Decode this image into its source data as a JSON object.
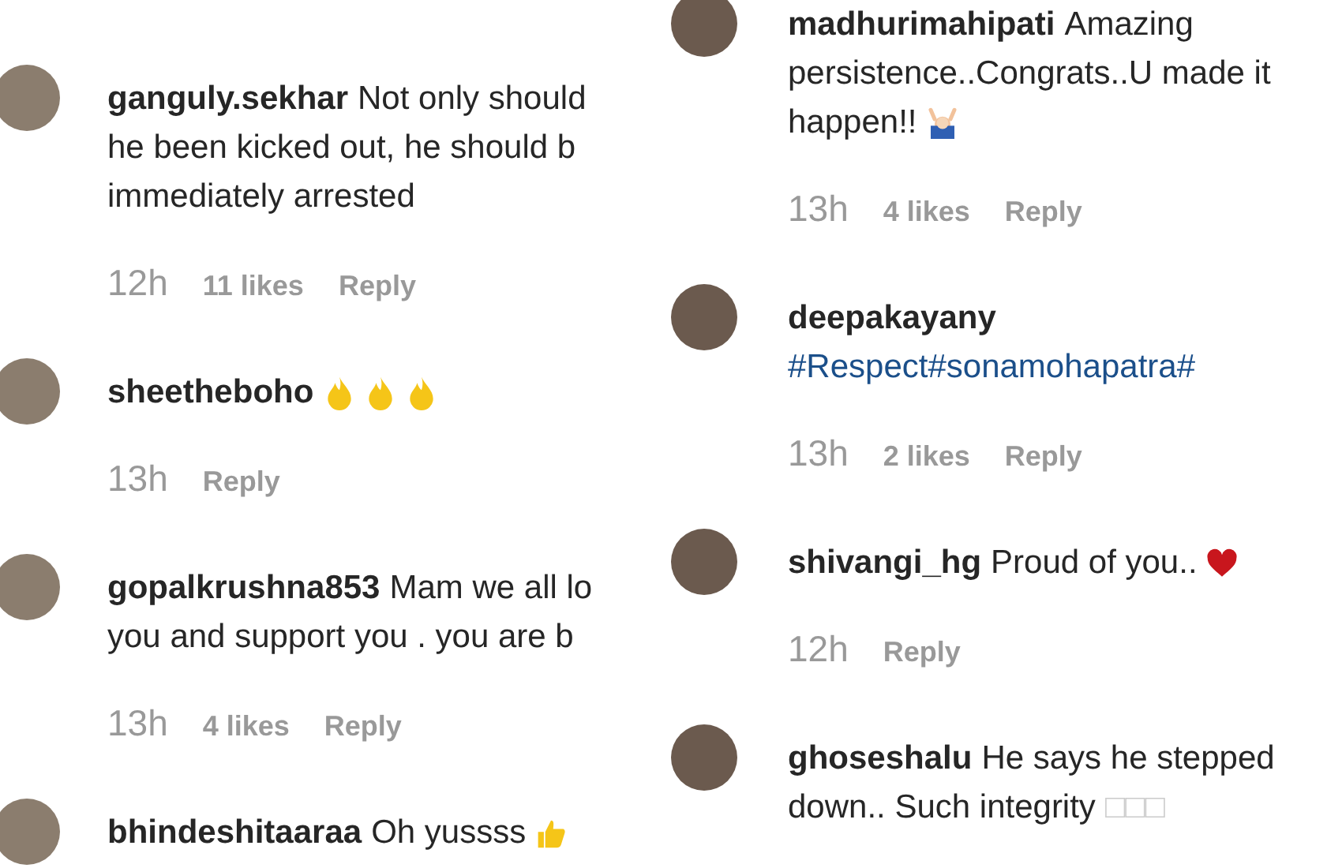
{
  "panels": [
    {
      "comments": [
        {
          "lines": [
            [
              {
                "kind": "username",
                "text": "ganguly.sekhar"
              },
              {
                "kind": "text",
                "text": "Not only should"
              }
            ],
            [
              {
                "kind": "text",
                "text": "he been kicked out, he should b"
              }
            ],
            [
              {
                "kind": "text",
                "text": "immediately arrested"
              }
            ]
          ],
          "time": "12h",
          "likes": "11 likes",
          "reply": "Reply"
        },
        {
          "lines": [
            [
              {
                "kind": "username",
                "text": "sheetheboho"
              },
              {
                "kind": "flame"
              },
              {
                "kind": "flame"
              },
              {
                "kind": "flame"
              }
            ]
          ],
          "time": "13h",
          "reply": "Reply"
        },
        {
          "lines": [
            [
              {
                "kind": "username",
                "text": "gopalkrushna853"
              },
              {
                "kind": "text",
                "text": "Mam we all lo"
              }
            ],
            [
              {
                "kind": "text",
                "text": "you and support you . you are b"
              }
            ]
          ],
          "time": "13h",
          "likes": "4 likes",
          "reply": "Reply"
        },
        {
          "lines": [
            [
              {
                "kind": "username",
                "text": "bhindeshitaaraa"
              },
              {
                "kind": "text",
                "text": "Oh yussss"
              },
              {
                "kind": "thumbs"
              }
            ]
          ]
        }
      ]
    },
    {
      "comments": [
        {
          "lines": [
            [
              {
                "kind": "username",
                "text": "madhurimahipati"
              },
              {
                "kind": "text",
                "text": "Amazing"
              }
            ],
            [
              {
                "kind": "text",
                "text": "persistence..Congrats..U made it"
              }
            ],
            [
              {
                "kind": "text",
                "text": "happen!!"
              },
              {
                "kind": "raised-hands"
              }
            ]
          ],
          "time": "13h",
          "likes": "4 likes",
          "reply": "Reply"
        },
        {
          "lines": [
            [
              {
                "kind": "username",
                "text": "deepakayany"
              }
            ],
            [
              {
                "kind": "hashtag",
                "text": "#Respect#sonamohapatra#"
              }
            ]
          ],
          "time": "13h",
          "likes": "2 likes",
          "reply": "Reply"
        },
        {
          "lines": [
            [
              {
                "kind": "username",
                "text": "shivangi_hg"
              },
              {
                "kind": "text",
                "text": "Proud of you.."
              },
              {
                "kind": "heart"
              }
            ]
          ],
          "time": "12h",
          "reply": "Reply"
        },
        {
          "lines": [
            [
              {
                "kind": "username",
                "text": "ghoseshalu"
              },
              {
                "kind": "text",
                "text": "He says he stepped"
              }
            ],
            [
              {
                "kind": "text",
                "text": "down.. Such integrity"
              },
              {
                "kind": "tofu",
                "text": "□□□"
              }
            ]
          ]
        }
      ]
    }
  ]
}
